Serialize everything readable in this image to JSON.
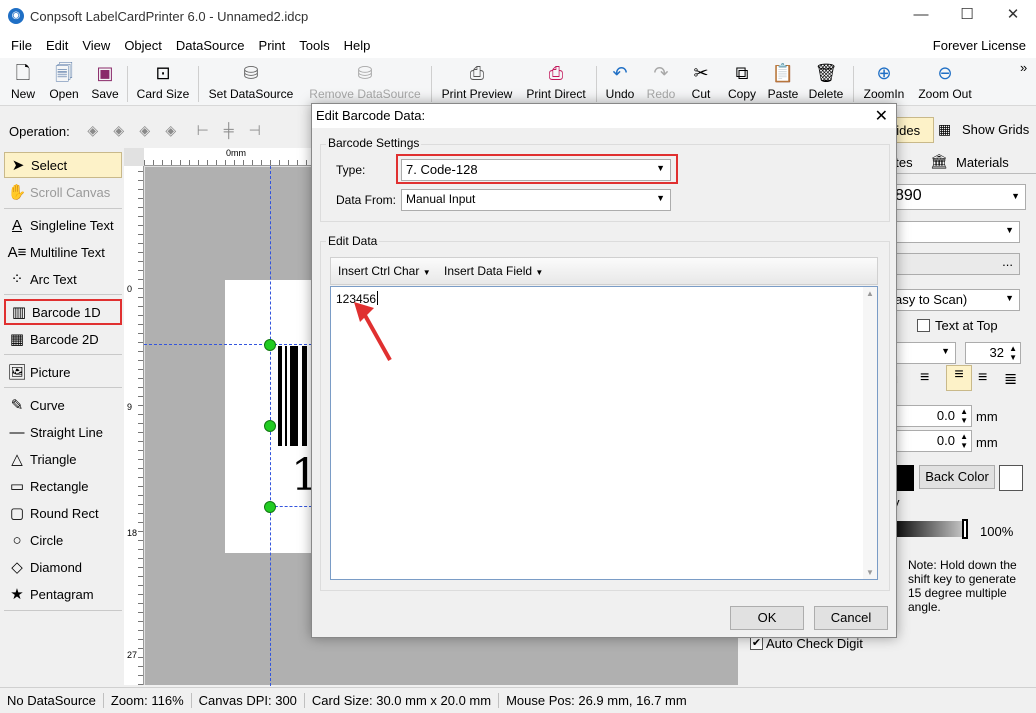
{
  "window": {
    "title": "Conpsoft LabelCardPrinter 6.0 - Unnamed2.idcp",
    "minimize": "—",
    "maximize": "☐",
    "close": "✕"
  },
  "menu": {
    "items": [
      "File",
      "Edit",
      "View",
      "Object",
      "DataSource",
      "Print",
      "Tools",
      "Help"
    ],
    "license": "Forever License"
  },
  "toolbar": {
    "new": "New",
    "open": "Open",
    "save": "Save",
    "card_size": "Card Size",
    "set_datasource": "Set DataSource",
    "remove_datasource": "Remove DataSource",
    "print_preview": "Print Preview",
    "print_direct": "Print Direct",
    "undo": "Undo",
    "redo": "Redo",
    "cut": "Cut",
    "copy": "Copy",
    "paste": "Paste",
    "delete": "Delete",
    "zoom_in": "ZoomIn",
    "zoom_out": "Zoom Out",
    "more": "»"
  },
  "operation": {
    "label": "Operation:"
  },
  "tools": {
    "select": "Select",
    "scroll_canvas": "Scroll Canvas",
    "singleline_text": "Singleline Text",
    "multiline_text": "Multiline Text",
    "arc_text": "Arc Text",
    "barcode_1d": "Barcode 1D",
    "barcode_2d": "Barcode 2D",
    "picture": "Picture",
    "curve": "Curve",
    "straight_line": "Straight Line",
    "triangle": "Triangle",
    "rectangle": "Rectangle",
    "round_rect": "Round Rect",
    "circle": "Circle",
    "diamond": "Diamond",
    "pentagram": "Pentagram"
  },
  "ruler": {
    "top_label": "0mm",
    "left_labels": [
      "0",
      "9",
      "18",
      "27"
    ]
  },
  "canvas": {
    "barcode_text": "1"
  },
  "right_panel": {
    "guides": "uides",
    "show_grids": "Show Grids",
    "tab_templates": "ates",
    "tab_materials": "Materials",
    "data_value": "890",
    "ellipsis": "...",
    "scan_option": "asy to Scan)",
    "text_at_top": "Text at Top",
    "font_size": "32",
    "offset_x": "0.0",
    "offset_y": "0.0",
    "unit": "mm",
    "back_color": "Back Color",
    "y_label": "y",
    "opacity": "100%",
    "note": "Note: Hold down the shift key to generate 15 degree multiple angle.",
    "auto_check_digit": "Auto Check Digit"
  },
  "dialog": {
    "title": "Edit Barcode Data:",
    "close": "✕",
    "settings_group": "Barcode Settings",
    "type_label": "Type:",
    "type_value": "7.  Code-128",
    "data_from_label": "Data From:",
    "data_from_value": "Manual Input",
    "edit_group": "Edit Data",
    "insert_ctrl_char": "Insert Ctrl Char",
    "insert_data_field": "Insert Data Field",
    "data_text": "123456",
    "ok": "OK",
    "cancel": "Cancel"
  },
  "status": {
    "datasource": "No DataSource",
    "zoom": "Zoom: 116%",
    "dpi": "Canvas DPI: 300",
    "card_size": "Card Size: 30.0 mm x 20.0 mm",
    "mouse_pos": "Mouse Pos: 26.9 mm, 16.7 mm"
  },
  "colors": {
    "accent": "#1f6fc5",
    "highlight": "#e03030",
    "handle": "#22cc22",
    "select_bg": "#fdf2c8"
  }
}
